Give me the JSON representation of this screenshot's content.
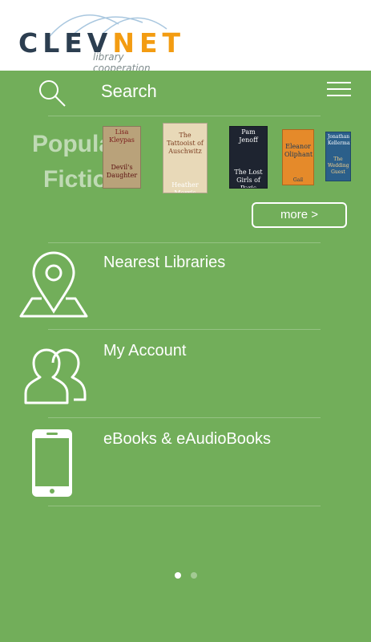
{
  "header": {
    "logo_word_dark": "CLEV",
    "logo_word_orange": "NET",
    "logo_subtitle": "library cooperation"
  },
  "search": {
    "label": "Search"
  },
  "carousel": {
    "title_line1": "Popular",
    "title_line2": "Fiction",
    "more_label": "more >",
    "books": [
      {
        "title": "Devil's Daughter",
        "author": "Lisa Kleypas",
        "color": "#b9a27a"
      },
      {
        "title": "The Tattooist of Auschwitz",
        "author": "Heather Morris",
        "color": "#e8d9b8"
      },
      {
        "title": "The Lost Girls of Paris",
        "author": "Pam Jenoff",
        "color": "#1e2430"
      },
      {
        "title": "Eleanor Oliphant",
        "author": "Gail Honeyman",
        "color": "#e58a2a"
      },
      {
        "title": "The Wedding Guest",
        "author": "Jonathan Kellerman",
        "color": "#2b5f8a"
      }
    ]
  },
  "menu": {
    "items": [
      {
        "label": "Nearest Libraries",
        "icon": "map-pin-icon"
      },
      {
        "label": "My Account",
        "icon": "users-icon"
      },
      {
        "label": "eBooks & eAudioBooks",
        "icon": "phone-icon"
      }
    ]
  },
  "pager": {
    "pages": 2,
    "active": 1
  },
  "colors": {
    "background": "#72ae5a",
    "accent": "#f39c12",
    "logo_dark": "#2c3e50"
  }
}
